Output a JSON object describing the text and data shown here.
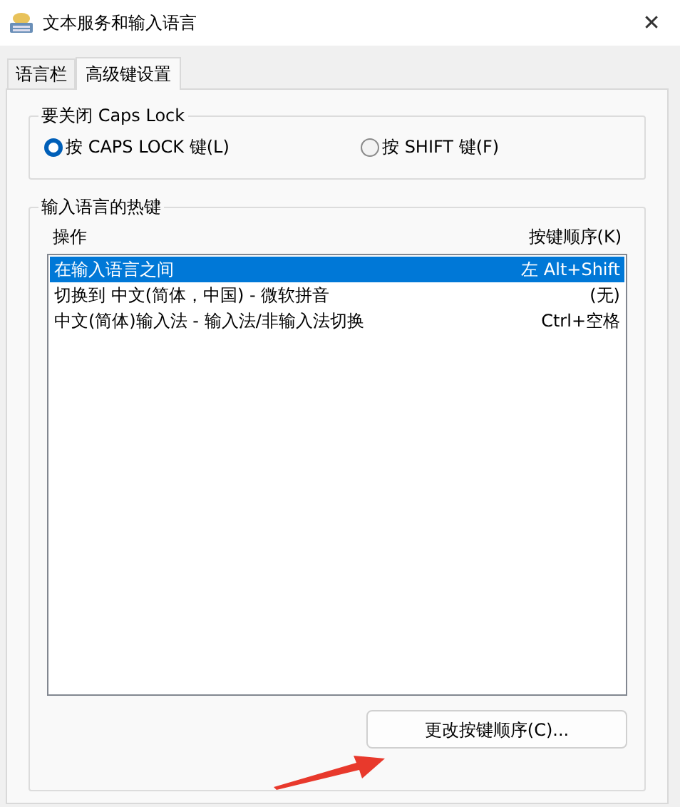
{
  "window": {
    "title": "文本服务和输入语言",
    "close": "✕"
  },
  "tabs": [
    {
      "label": "语言栏",
      "selected": false
    },
    {
      "label": "高级键设置",
      "selected": true
    }
  ],
  "caps_lock": {
    "title": "要关闭 Caps Lock",
    "options": [
      {
        "label": "按 CAPS LOCK 键(L)",
        "selected": true
      },
      {
        "label": "按 SHIFT 键(F)",
        "selected": false
      }
    ]
  },
  "hotkeys": {
    "title": "输入语言的热键",
    "columns": [
      "操作",
      "按键顺序(K)"
    ],
    "rows": [
      {
        "action": "在输入语言之间",
        "keys": "左 Alt+Shift",
        "selected": true
      },
      {
        "action": "切换到 中文(简体，中国) - 微软拼音",
        "keys": "(无)",
        "selected": false
      },
      {
        "action": "中文(简体)输入法 - 输入法/非输入法切换",
        "keys": "Ctrl+空格",
        "selected": false
      }
    ],
    "button": "更改按键顺序(C)..."
  }
}
